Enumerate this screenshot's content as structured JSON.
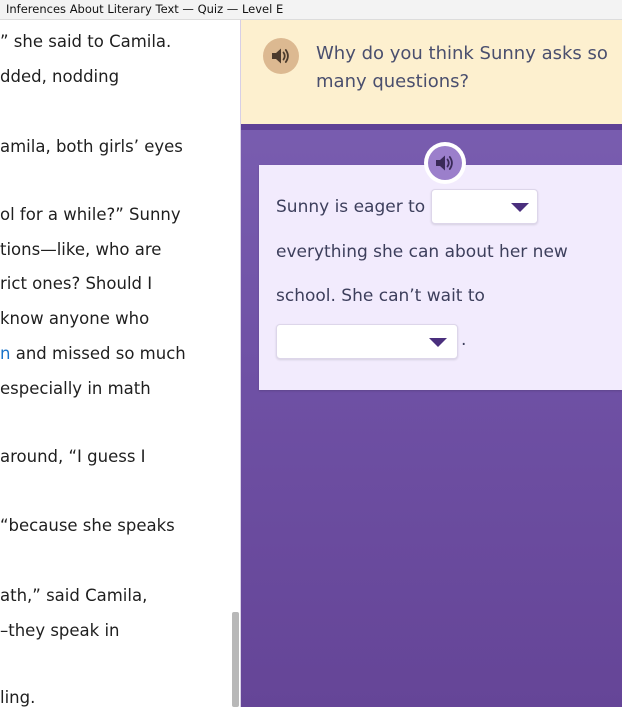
{
  "window": {
    "title": "Inferences About Literary Text — Quiz — Level E"
  },
  "passage": {
    "lines": [
      {
        "text": "” she said to Camila."
      },
      {
        "text": "dded, nodding"
      },
      {
        "text": "amila, both girls’ eyes"
      },
      {
        "text": "ol for a while?” Sunny"
      },
      {
        "text": "tions—like, who are"
      },
      {
        "text": "rict ones? Should I"
      },
      {
        "text": " know anyone who"
      },
      {
        "link": "n",
        "text": " and missed so much"
      },
      {
        "text": " especially in math"
      },
      {
        "text": " around, “I guess I"
      },
      {
        "text": " “because she speaks"
      },
      {
        "text": "ath,” said Camila,"
      },
      {
        "text": "–they speak in"
      },
      {
        "text": "ling."
      }
    ]
  },
  "question": {
    "text": "Why do you think Sunny asks so many questions?",
    "audio_icon": "speaker-icon"
  },
  "answer": {
    "line1_prefix": "Sunny is eager to",
    "line2": "everything she can about her new",
    "line3": "school. She can’t wait to",
    "line4_suffix": ".",
    "dropdown1_value": "",
    "dropdown2_value": "",
    "audio_icon": "speaker-icon"
  },
  "colors": {
    "accent_purple": "#6f51a5",
    "banner_yellow": "#fdf0cf",
    "card_lavender": "#f2ebfd",
    "link_blue": "#1a73c9"
  }
}
